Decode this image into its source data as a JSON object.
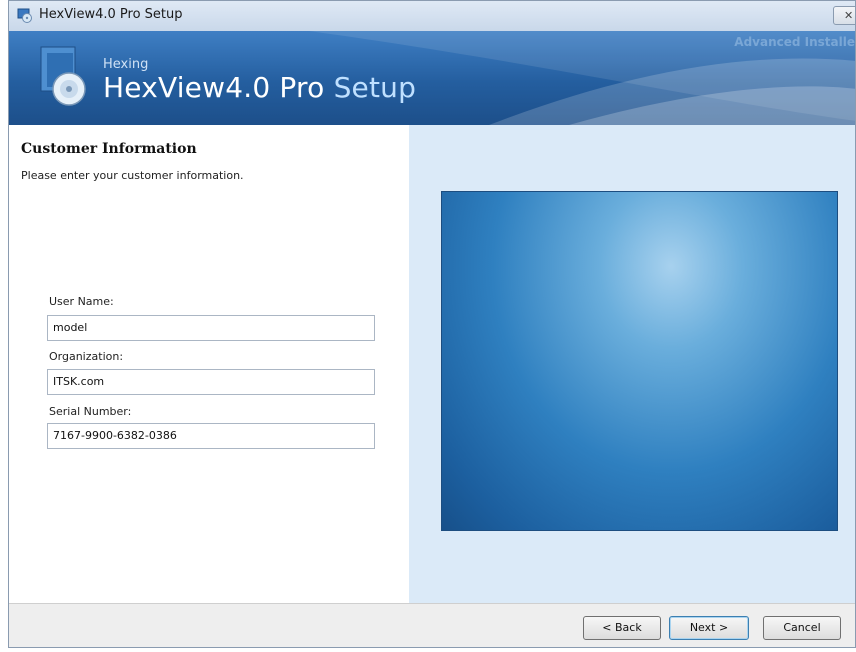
{
  "window": {
    "title": "HexView4.0 Pro Setup",
    "close_glyph": "✕"
  },
  "banner": {
    "brand": "Hexing",
    "product": "HexView4.0 Pro",
    "product_suffix": "Setup",
    "tagline": "Advanced Installe",
    "logo_icon": "installer-disc-icon"
  },
  "page": {
    "heading": "Customer Information",
    "subtitle": "Please enter your customer information."
  },
  "form": {
    "user_name": {
      "label": "User Name:",
      "value": "model"
    },
    "organization": {
      "label": "Organization:",
      "value": "ITSK.com"
    },
    "serial_number": {
      "label": "Serial Number:",
      "value": "7167-9900-6382-0386"
    }
  },
  "buttons": {
    "back": "< Back",
    "next": "Next >",
    "cancel": "Cancel"
  },
  "colors": {
    "banner": "#245e9f",
    "right_panel": "#dbeaf8",
    "preview": "#2f80c0"
  }
}
